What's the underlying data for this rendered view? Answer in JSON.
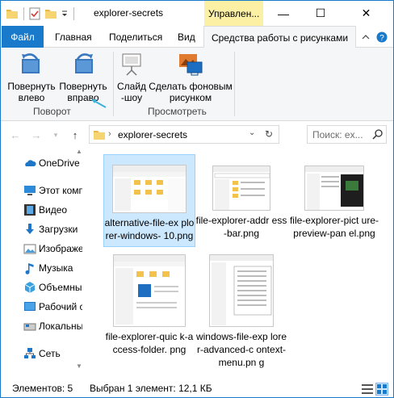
{
  "window": {
    "title": "explorer-secrets",
    "context_tab_header": "Управлен...",
    "controls": {
      "minimize": "—",
      "maximize": "☐",
      "close": "✕"
    }
  },
  "ribbon_tabs": {
    "file": "Файл",
    "home": "Главная",
    "share": "Поделиться",
    "view": "Вид",
    "picture_tools": "Средства работы с рисунками"
  },
  "ribbon": {
    "rotate_left": "Повернуть влево",
    "rotate_right": "Повернуть вправо",
    "rotate_group": "Поворот",
    "slideshow": "Слайд -шоу",
    "set_background": "Сделать фоновым рисунком",
    "view_group": "Просмотреть"
  },
  "address": {
    "path": "explorer-secrets",
    "search_placeholder": "Поиск: ex..."
  },
  "nav_pane": {
    "items": [
      {
        "label": "OneDrive",
        "icon": "cloud-icon"
      },
      {
        "label": "Этот компьютер",
        "icon": "computer-icon"
      },
      {
        "label": "Видео",
        "icon": "video-icon"
      },
      {
        "label": "Загрузки",
        "icon": "download-icon"
      },
      {
        "label": "Изображения",
        "icon": "pictures-icon"
      },
      {
        "label": "Музыка",
        "icon": "music-icon"
      },
      {
        "label": "Объемные объекты",
        "icon": "3d-icon"
      },
      {
        "label": "Рабочий стол",
        "icon": "desktop-icon"
      },
      {
        "label": "Локальный диск",
        "icon": "disk-icon"
      },
      {
        "label": "Сеть",
        "icon": "network-icon"
      }
    ]
  },
  "files": [
    {
      "name": "alternative-file-explorer-windows-10.png",
      "caption": "alternative-file-ex plorer-windows- 10.png",
      "selected": true
    },
    {
      "name": "file-explorer-address-bar.png",
      "caption": "file-explorer-addr ess-bar.png",
      "selected": false
    },
    {
      "name": "file-explorer-picture-preview-panel.png",
      "caption": "file-explorer-pict ure-preview-pan el.png",
      "selected": false
    },
    {
      "name": "file-explorer-quick-access-folder.png",
      "caption": "file-explorer-quic k-access-folder. png",
      "selected": false
    },
    {
      "name": "windows-file-explorer-advanced-context-menu.png",
      "caption": "windows-file-exp lorer-advanced-c ontext-menu.pn g",
      "selected": false
    }
  ],
  "status": {
    "items_count": "Элементов: 5",
    "selected": "Выбран 1 элемент: 12,1 КБ"
  },
  "colors": {
    "accent": "#1979ca",
    "context_tab": "#fbf0a4",
    "selection": "#cce8ff",
    "ribbon_bg": "#f5f6f7"
  }
}
